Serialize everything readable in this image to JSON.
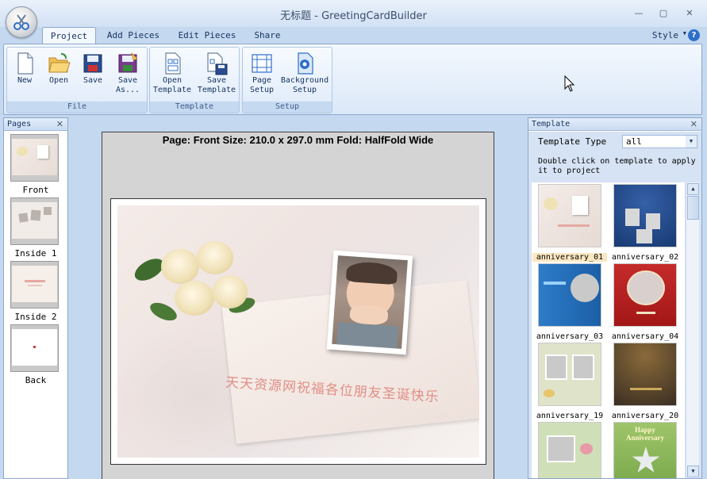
{
  "window": {
    "title": "无标题 - GreetingCardBuilder",
    "minimize_symbol": "—",
    "maximize_symbol": "▢",
    "close_symbol": "✕"
  },
  "ribbon_tabs": [
    {
      "label": "Project",
      "active": true
    },
    {
      "label": "Add Pieces",
      "active": false
    },
    {
      "label": "Edit Pieces",
      "active": false
    },
    {
      "label": "Share",
      "active": false
    }
  ],
  "style_menu": {
    "label": "Style",
    "help_symbol": "?"
  },
  "ribbon_groups": {
    "file": {
      "label": "File",
      "buttons": [
        {
          "label": "New",
          "icon": "new-file-icon"
        },
        {
          "label": "Open",
          "icon": "open-folder-icon"
        },
        {
          "label": "Save",
          "icon": "save-disk-icon"
        },
        {
          "label": "Save As...",
          "icon": "save-as-icon"
        }
      ]
    },
    "template": {
      "label": "Template",
      "buttons": [
        {
          "line1": "Open",
          "line2": "Template",
          "icon": "open-template-icon"
        },
        {
          "line1": "Save",
          "line2": "Template",
          "icon": "save-template-icon"
        }
      ]
    },
    "setup": {
      "label": "Setup",
      "buttons": [
        {
          "line1": "Page",
          "line2": "Setup",
          "icon": "page-setup-icon"
        },
        {
          "line1": "Background",
          "line2": "Setup",
          "icon": "background-setup-icon"
        }
      ]
    }
  },
  "pages_panel": {
    "title": "Pages",
    "close_symbol": "✕",
    "pages": [
      {
        "label": "Front"
      },
      {
        "label": "Inside 1"
      },
      {
        "label": "Inside 2"
      },
      {
        "label": "Back"
      }
    ]
  },
  "canvas": {
    "page_info": "Page: Front   Size: 210.0 x 297.0 mm   Fold: HalfFold Wide",
    "card_text": "天天资源网祝福各位朋友圣诞快乐"
  },
  "template_panel": {
    "title": "Template",
    "close_symbol": "✕",
    "type_label": "Template Type",
    "type_value": "all",
    "hint": "Double click on template to apply it to project",
    "items": [
      {
        "name": "anniversary_01",
        "selected": true
      },
      {
        "name": "anniversary_02",
        "selected": false
      },
      {
        "name": "anniversary_03",
        "selected": false
      },
      {
        "name": "anniversary_04",
        "selected": false
      },
      {
        "name": "anniversary_19",
        "selected": false
      },
      {
        "name": "anniversary_20",
        "selected": false
      }
    ],
    "partial_item_text": "Happy Anniversary"
  },
  "colors": {
    "app_background": "#c4d8ef",
    "ribbon_text": "#15325e",
    "card_text": "#e08f86",
    "selected_template": "#fbe7c1"
  }
}
